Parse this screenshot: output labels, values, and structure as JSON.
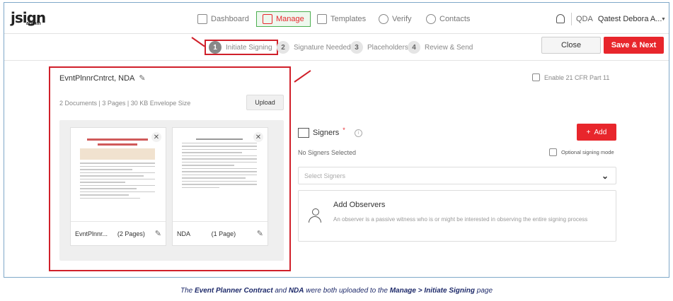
{
  "brand": {
    "logo_text": "jsign",
    "logo_sub": "admin",
    "accent": "#e8262c"
  },
  "nav": {
    "items": [
      {
        "label": "Dashboard",
        "icon": "dashboard-icon"
      },
      {
        "label": "Manage",
        "icon": "document-icon",
        "active": true
      },
      {
        "label": "Templates",
        "icon": "template-icon"
      },
      {
        "label": "Verify",
        "icon": "verify-icon"
      },
      {
        "label": "Contacts",
        "icon": "contacts-icon"
      }
    ],
    "user_initials": "QDA",
    "user_name": "Qatest Debora A..."
  },
  "steps": [
    {
      "num": "1",
      "label": "Initiate Signing",
      "active": true
    },
    {
      "num": "2",
      "label": "Signature Needed"
    },
    {
      "num": "3",
      "label": "Placeholders"
    },
    {
      "num": "4",
      "label": "Review & Send"
    }
  ],
  "actions": {
    "close_label": "Close",
    "save_label": "Save & Next"
  },
  "envelope": {
    "name": "EvntPlnnrCntrct, NDA",
    "summary": "2 Documents | 3 Pages | 30 KB Envelope Size",
    "upload_label": "Upload",
    "documents": [
      {
        "name": "EvntPlnnr...",
        "pages": "(2 Pages)"
      },
      {
        "name": "NDA",
        "pages": "(1 Page)"
      }
    ]
  },
  "compliance": {
    "cfr_label": "Enable 21 CFR Part 11"
  },
  "signers": {
    "title": "Signers",
    "required_mark": "*",
    "add_label": "Add",
    "empty_text": "No Signers Selected",
    "optional_mode_label": "Optional signing mode",
    "select_placeholder": "Select Signers"
  },
  "observers": {
    "title": "Add Observers",
    "description": "An observer is a passive witness who is or might be interested in observing the entire signing process"
  },
  "caption": {
    "prefix": "The ",
    "doc1": "Event Planner Contract",
    "and": " and ",
    "doc2": "NDA",
    "mid": " were both uploaded to the ",
    "path": "Manage > Initiate Signing",
    "suffix": " page"
  }
}
